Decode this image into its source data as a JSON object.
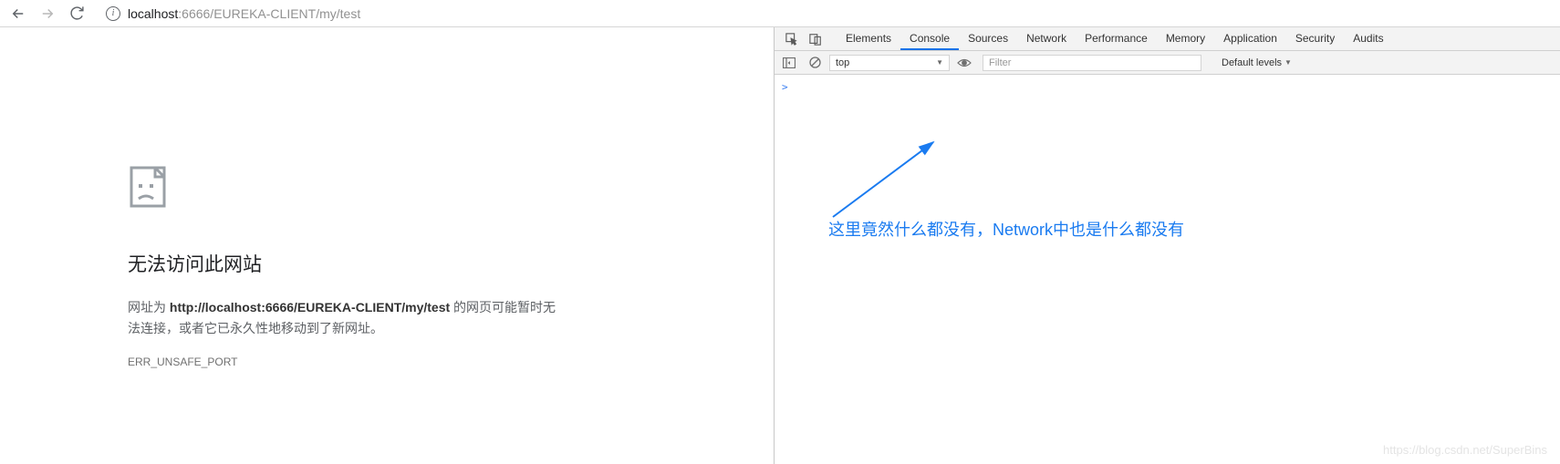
{
  "toolbar": {
    "url_prefix": "localhost",
    "url_port_path": ":6666/EUREKA-CLIENT/my/test"
  },
  "error": {
    "title": "无法访问此网站",
    "desc_pre": "网址为 ",
    "desc_url": "http://localhost:6666/EUREKA-CLIENT/my/test",
    "desc_post": " 的网页可能暂时无法连接，或者它已永久性地移动到了新网址。",
    "code": "ERR_UNSAFE_PORT"
  },
  "devtools": {
    "tabs": [
      "Elements",
      "Console",
      "Sources",
      "Network",
      "Performance",
      "Memory",
      "Application",
      "Security",
      "Audits"
    ],
    "active_tab": "Console",
    "context": "top",
    "filter_placeholder": "Filter",
    "levels": "Default levels",
    "prompt": ">"
  },
  "annotation": "这里竟然什么都没有，Network中也是什么都没有",
  "watermark": "https://blog.csdn.net/SuperBins"
}
